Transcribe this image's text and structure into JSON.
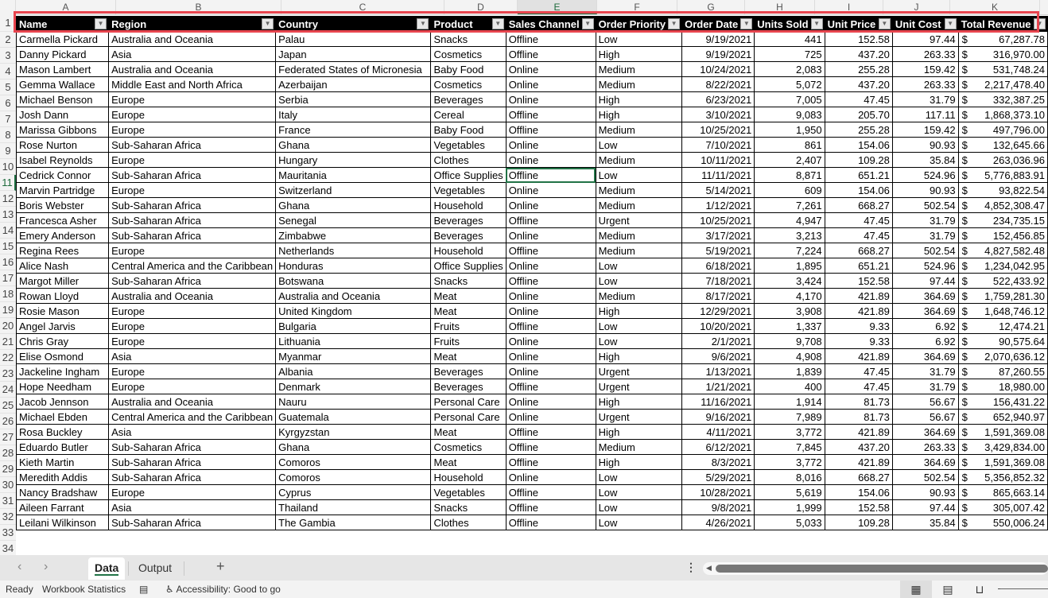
{
  "columns": [
    "A",
    "B",
    "C",
    "D",
    "E",
    "F",
    "G",
    "H",
    "I",
    "J",
    "K"
  ],
  "active_column": "E",
  "active_row": 11,
  "headers": [
    "Name",
    "Region",
    "Country",
    "Product",
    "Sales Channel",
    "Order Priority",
    "Order Date",
    "Units Sold",
    "Unit Price",
    "Unit Cost",
    "Total Revenue"
  ],
  "rows": [
    {
      "n": 2,
      "name": "Carmella Pickard",
      "region": "Australia and Oceania",
      "country": "Palau",
      "product": "Snacks",
      "channel": "Offline",
      "priority": "Low",
      "date": "9/19/2021",
      "units": "441",
      "price": "152.58",
      "cost": "97.44",
      "revenue": "67,287.78"
    },
    {
      "n": 3,
      "name": "Danny Pickard",
      "region": "Asia",
      "country": "Japan",
      "product": "Cosmetics",
      "channel": "Offline",
      "priority": "High",
      "date": "9/19/2021",
      "units": "725",
      "price": "437.20",
      "cost": "263.33",
      "revenue": "316,970.00"
    },
    {
      "n": 4,
      "name": "Mason Lambert",
      "region": "Australia and Oceania",
      "country": "Federated States of Micronesia",
      "product": "Baby Food",
      "channel": "Online",
      "priority": "Medium",
      "date": "10/24/2021",
      "units": "2,083",
      "price": "255.28",
      "cost": "159.42",
      "revenue": "531,748.24"
    },
    {
      "n": 5,
      "name": "Gemma Wallace",
      "region": "Middle East and North Africa",
      "country": "Azerbaijan",
      "product": "Cosmetics",
      "channel": "Online",
      "priority": "Medium",
      "date": "8/22/2021",
      "units": "5,072",
      "price": "437.20",
      "cost": "263.33",
      "revenue": "2,217,478.40"
    },
    {
      "n": 6,
      "name": "Michael Benson",
      "region": "Europe",
      "country": "Serbia",
      "product": "Beverages",
      "channel": "Online",
      "priority": "High",
      "date": "6/23/2021",
      "units": "7,005",
      "price": "47.45",
      "cost": "31.79",
      "revenue": "332,387.25"
    },
    {
      "n": 7,
      "name": "Josh Dann",
      "region": "Europe",
      "country": "Italy",
      "product": "Cereal",
      "channel": "Offline",
      "priority": "High",
      "date": "3/10/2021",
      "units": "9,083",
      "price": "205.70",
      "cost": "117.11",
      "revenue": "1,868,373.10"
    },
    {
      "n": 8,
      "name": "Marissa Gibbons",
      "region": "Europe",
      "country": "France",
      "product": "Baby Food",
      "channel": "Offline",
      "priority": "Medium",
      "date": "10/25/2021",
      "units": "1,950",
      "price": "255.28",
      "cost": "159.42",
      "revenue": "497,796.00"
    },
    {
      "n": 9,
      "name": "Rose Nurton",
      "region": "Sub-Saharan Africa",
      "country": "Ghana",
      "product": "Vegetables",
      "channel": "Online",
      "priority": "Low",
      "date": "7/10/2021",
      "units": "861",
      "price": "154.06",
      "cost": "90.93",
      "revenue": "132,645.66"
    },
    {
      "n": 10,
      "name": "Isabel Reynolds",
      "region": "Europe",
      "country": "Hungary",
      "product": "Clothes",
      "channel": "Online",
      "priority": "Medium",
      "date": "10/11/2021",
      "units": "2,407",
      "price": "109.28",
      "cost": "35.84",
      "revenue": "263,036.96"
    },
    {
      "n": 11,
      "name": "Cedrick Connor",
      "region": "Sub-Saharan Africa",
      "country": "Mauritania",
      "product": "Office Supplies",
      "channel": "Offline",
      "priority": "Low",
      "date": "11/11/2021",
      "units": "8,871",
      "price": "651.21",
      "cost": "524.96",
      "revenue": "5,776,883.91"
    },
    {
      "n": 12,
      "name": "Marvin Partridge",
      "region": "Europe",
      "country": "Switzerland",
      "product": "Vegetables",
      "channel": "Online",
      "priority": "Medium",
      "date": "5/14/2021",
      "units": "609",
      "price": "154.06",
      "cost": "90.93",
      "revenue": "93,822.54"
    },
    {
      "n": 13,
      "name": "Boris Webster",
      "region": "Sub-Saharan Africa",
      "country": "Ghana",
      "product": "Household",
      "channel": "Online",
      "priority": "Medium",
      "date": "1/12/2021",
      "units": "7,261",
      "price": "668.27",
      "cost": "502.54",
      "revenue": "4,852,308.47"
    },
    {
      "n": 14,
      "name": "Francesca Asher",
      "region": "Sub-Saharan Africa",
      "country": "Senegal",
      "product": "Beverages",
      "channel": "Offline",
      "priority": "Urgent",
      "date": "10/25/2021",
      "units": "4,947",
      "price": "47.45",
      "cost": "31.79",
      "revenue": "234,735.15"
    },
    {
      "n": 15,
      "name": "Emery Anderson",
      "region": "Sub-Saharan Africa",
      "country": "Zimbabwe",
      "product": "Beverages",
      "channel": "Online",
      "priority": "Medium",
      "date": "3/17/2021",
      "units": "3,213",
      "price": "47.45",
      "cost": "31.79",
      "revenue": "152,456.85"
    },
    {
      "n": 16,
      "name": "Regina Rees",
      "region": "Europe",
      "country": "Netherlands",
      "product": "Household",
      "channel": "Offline",
      "priority": "Medium",
      "date": "5/19/2021",
      "units": "7,224",
      "price": "668.27",
      "cost": "502.54",
      "revenue": "4,827,582.48"
    },
    {
      "n": 17,
      "name": "Alice Nash",
      "region": "Central America and the Caribbean",
      "country": "Honduras",
      "product": "Office Supplies",
      "channel": "Online",
      "priority": "Low",
      "date": "6/18/2021",
      "units": "1,895",
      "price": "651.21",
      "cost": "524.96",
      "revenue": "1,234,042.95"
    },
    {
      "n": 18,
      "name": "Margot Miller",
      "region": "Sub-Saharan Africa",
      "country": "Botswana",
      "product": "Snacks",
      "channel": "Offline",
      "priority": "Low",
      "date": "7/18/2021",
      "units": "3,424",
      "price": "152.58",
      "cost": "97.44",
      "revenue": "522,433.92"
    },
    {
      "n": 19,
      "name": "Rowan Lloyd",
      "region": "Australia and Oceania",
      "country": "Australia and Oceania",
      "product": "Meat",
      "channel": "Online",
      "priority": "Medium",
      "date": "8/17/2021",
      "units": "4,170",
      "price": "421.89",
      "cost": "364.69",
      "revenue": "1,759,281.30"
    },
    {
      "n": 20,
      "name": "Rosie Mason",
      "region": "Europe",
      "country": "United Kingdom",
      "product": "Meat",
      "channel": "Online",
      "priority": "High",
      "date": "12/29/2021",
      "units": "3,908",
      "price": "421.89",
      "cost": "364.69",
      "revenue": "1,648,746.12"
    },
    {
      "n": 21,
      "name": "Angel Jarvis",
      "region": "Europe",
      "country": "Bulgaria",
      "product": "Fruits",
      "channel": "Offline",
      "priority": "Low",
      "date": "10/20/2021",
      "units": "1,337",
      "price": "9.33",
      "cost": "6.92",
      "revenue": "12,474.21"
    },
    {
      "n": 22,
      "name": "Chris Gray",
      "region": "Europe",
      "country": "Lithuania",
      "product": "Fruits",
      "channel": "Online",
      "priority": "Low",
      "date": "2/1/2021",
      "units": "9,708",
      "price": "9.33",
      "cost": "6.92",
      "revenue": "90,575.64"
    },
    {
      "n": 23,
      "name": "Elise Osmond",
      "region": "Asia",
      "country": "Myanmar",
      "product": "Meat",
      "channel": "Online",
      "priority": "High",
      "date": "9/6/2021",
      "units": "4,908",
      "price": "421.89",
      "cost": "364.69",
      "revenue": "2,070,636.12"
    },
    {
      "n": 24,
      "name": "Jackeline Ingham",
      "region": "Europe",
      "country": "Albania",
      "product": "Beverages",
      "channel": "Online",
      "priority": "Urgent",
      "date": "1/13/2021",
      "units": "1,839",
      "price": "47.45",
      "cost": "31.79",
      "revenue": "87,260.55"
    },
    {
      "n": 25,
      "name": "Hope Needham",
      "region": "Europe",
      "country": "Denmark",
      "product": "Beverages",
      "channel": "Offline",
      "priority": "Urgent",
      "date": "1/21/2021",
      "units": "400",
      "price": "47.45",
      "cost": "31.79",
      "revenue": "18,980.00"
    },
    {
      "n": 26,
      "name": "Jacob Jennson",
      "region": "Australia and Oceania",
      "country": "Nauru",
      "product": "Personal Care",
      "channel": "Online",
      "priority": "High",
      "date": "11/16/2021",
      "units": "1,914",
      "price": "81.73",
      "cost": "56.67",
      "revenue": "156,431.22"
    },
    {
      "n": 27,
      "name": "Michael Ebden",
      "region": "Central America and the Caribbean",
      "country": "Guatemala",
      "product": "Personal Care",
      "channel": "Online",
      "priority": "Urgent",
      "date": "9/16/2021",
      "units": "7,989",
      "price": "81.73",
      "cost": "56.67",
      "revenue": "652,940.97"
    },
    {
      "n": 28,
      "name": "Rosa Buckley",
      "region": "Asia",
      "country": "Kyrgyzstan",
      "product": "Meat",
      "channel": "Offline",
      "priority": "High",
      "date": "4/11/2021",
      "units": "3,772",
      "price": "421.89",
      "cost": "364.69",
      "revenue": "1,591,369.08"
    },
    {
      "n": 29,
      "name": "Eduardo Butler",
      "region": "Sub-Saharan Africa",
      "country": "Ghana",
      "product": "Cosmetics",
      "channel": "Offline",
      "priority": "Medium",
      "date": "6/12/2021",
      "units": "7,845",
      "price": "437.20",
      "cost": "263.33",
      "revenue": "3,429,834.00"
    },
    {
      "n": 30,
      "name": "Kieth Martin",
      "region": "Sub-Saharan Africa",
      "country": "Comoros",
      "product": "Meat",
      "channel": "Offline",
      "priority": "High",
      "date": "8/3/2021",
      "units": "3,772",
      "price": "421.89",
      "cost": "364.69",
      "revenue": "1,591,369.08"
    },
    {
      "n": 31,
      "name": "Meredith Addis",
      "region": "Sub-Saharan Africa",
      "country": "Comoros",
      "product": "Household",
      "channel": "Online",
      "priority": "Low",
      "date": "5/29/2021",
      "units": "8,016",
      "price": "668.27",
      "cost": "502.54",
      "revenue": "5,356,852.32"
    },
    {
      "n": 32,
      "name": "Nancy Bradshaw",
      "region": "Europe",
      "country": "Cyprus",
      "product": "Vegetables",
      "channel": "Offline",
      "priority": "Low",
      "date": "10/28/2021",
      "units": "5,619",
      "price": "154.06",
      "cost": "90.93",
      "revenue": "865,663.14"
    },
    {
      "n": 33,
      "name": "Aileen Farrant",
      "region": "Asia",
      "country": "Thailand",
      "product": "Snacks",
      "channel": "Offline",
      "priority": "Low",
      "date": "9/8/2021",
      "units": "1,999",
      "price": "152.58",
      "cost": "97.44",
      "revenue": "305,007.42"
    },
    {
      "n": 34,
      "name": "Leilani Wilkinson",
      "region": "Sub-Saharan Africa",
      "country": "The Gambia",
      "product": "Clothes",
      "channel": "Offline",
      "priority": "Low",
      "date": "4/26/2021",
      "units": "5,033",
      "price": "109.28",
      "cost": "35.84",
      "revenue": "550,006.24"
    }
  ],
  "currency_symbol": "$",
  "sheet_tabs": [
    {
      "label": "Data",
      "active": true
    },
    {
      "label": "Output",
      "active": false
    }
  ],
  "nav": {
    "prev": "‹",
    "next": "›",
    "add": "+",
    "more": "⋮"
  },
  "status": {
    "ready": "Ready",
    "workbook_stats": "Workbook Statistics",
    "accessibility": "Accessibility: Good to go"
  },
  "colors": {
    "accent": "#217346",
    "highlight": "#e8454f",
    "header_bg": "#000000"
  }
}
